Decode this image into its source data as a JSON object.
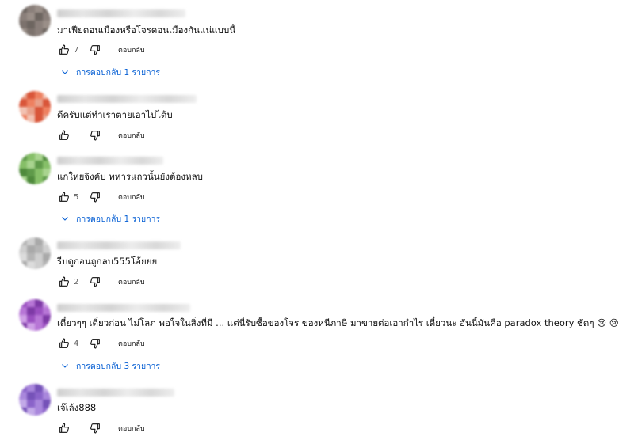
{
  "comments": [
    {
      "text": "มาเฟียดอนเมืองหรือโจรดอนเมืองกันแน่แบบนี้",
      "likes": "7",
      "reply_label": "ตอบกลับ",
      "replies_label": "การตอบกลับ 1 รายการ",
      "avatar_colors": [
        "#6d6560",
        "#8a7f7a",
        "#9a8f88",
        "#7c726d"
      ]
    },
    {
      "text": "ดีครับแต่ทำเราตายเอาไปได้บ",
      "likes": "",
      "reply_label": "ตอบกลับ",
      "replies_label": "",
      "avatar_colors": [
        "#e8a08a",
        "#d9563a",
        "#ee8060",
        "#f2c2b2"
      ]
    },
    {
      "text": "แกใหยจิงคับ ทหารแถวนั้นยังต้องหลบ",
      "likes": "5",
      "reply_label": "ตอบกลับ",
      "replies_label": "การตอบกลับ 1 รายการ",
      "avatar_colors": [
        "#5f9a4a",
        "#86bf68",
        "#a9d48f",
        "#4f8a3c"
      ]
    },
    {
      "text": "รีบดูก่อนถูกลบ555โอ้ยยย",
      "likes": "2",
      "reply_label": "ตอบกลับ",
      "replies_label": "",
      "avatar_colors": [
        "#b5b5b5",
        "#cfcfcf",
        "#a9a9a9",
        "#dcdcdc"
      ]
    },
    {
      "text": "เดี๋ยวๆๆ เดี๋ยวก่อน ไม่โลภ พอใจในสิ่งที่มี ... แต่นี่รับซื้อของโจร ของหนีภาษี มาขายต่อเอากำไร เดี๋ยวนะ อันนี้มันคือ paradox theory ชัดๆ 😢 😢",
      "likes": "4",
      "reply_label": "ตอบกลับ",
      "replies_label": "การตอบกลับ 3 รายการ",
      "avatar_colors": [
        "#9a4fc0",
        "#b776d6",
        "#7e3aa6",
        "#cfa0e6"
      ]
    },
    {
      "text": "เจ๊เล้ง888",
      "likes": "",
      "reply_label": "ตอบกลับ",
      "replies_label": "",
      "avatar_colors": [
        "#8a63c9",
        "#a987dc",
        "#7552b8",
        "#c3aae8"
      ]
    }
  ]
}
